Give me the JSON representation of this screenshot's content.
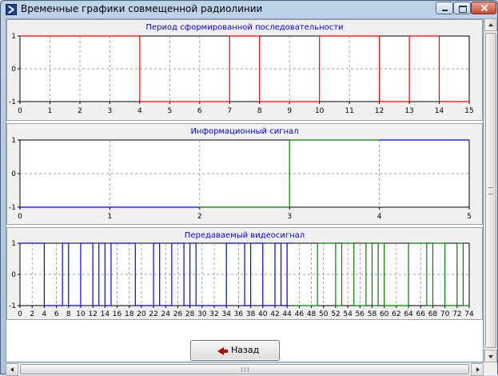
{
  "window": {
    "title": "Временные графики совмещенной радиолинии",
    "controls": [
      "minimize",
      "maximize",
      "close"
    ]
  },
  "icons": {
    "app": "app-icon",
    "back": "red-left-arrow-icon"
  },
  "buttons": {
    "back_label": "Назад"
  },
  "colors": {
    "panel_bg": "#f0f0f0",
    "plot_bg": "#ffffff",
    "grid": "#808080",
    "title_text": "#0000ff",
    "red_series": "#ff0000",
    "blue_series": "#0000ff",
    "green_series": "#008000"
  },
  "chart_data": [
    {
      "type": "line",
      "step": true,
      "title": "Период сформированной последовательности",
      "xlim": [
        0,
        15
      ],
      "ylim": [
        -1,
        1
      ],
      "xticks": [
        0,
        1,
        2,
        3,
        4,
        5,
        6,
        7,
        8,
        9,
        10,
        11,
        12,
        13,
        14,
        15
      ],
      "yticks": [
        1,
        0,
        -1
      ],
      "grid": true,
      "series": [
        {
          "color": "#ff0000",
          "x": [
            0,
            4,
            7,
            8,
            10,
            12,
            13,
            14,
            15
          ],
          "y": [
            1,
            -1,
            1,
            -1,
            1,
            -1,
            1,
            -1,
            -1
          ]
        }
      ]
    },
    {
      "type": "line",
      "step": true,
      "title": "Информационный сигнал",
      "xlim": [
        0,
        5
      ],
      "ylim": [
        -1,
        1
      ],
      "xticks": [
        0,
        1,
        2,
        3,
        4,
        5
      ],
      "yticks": [
        1,
        0,
        -1
      ],
      "grid": true,
      "series": [
        {
          "color": "#0000ff",
          "x": [
            0,
            2
          ],
          "y": [
            -1,
            -1
          ]
        },
        {
          "color": "#008000",
          "x": [
            2,
            3,
            4
          ],
          "y": [
            -1,
            1,
            1
          ]
        },
        {
          "color": "#0000ff",
          "x": [
            4,
            5
          ],
          "y": [
            1,
            1
          ]
        }
      ]
    },
    {
      "type": "line",
      "step": true,
      "title": "Передаваемый видеосигнал",
      "xlim": [
        0,
        74
      ],
      "ylim": [
        -1,
        1
      ],
      "xticks": [
        0,
        2,
        4,
        6,
        8,
        10,
        12,
        14,
        16,
        18,
        20,
        22,
        24,
        26,
        28,
        30,
        32,
        34,
        36,
        38,
        40,
        42,
        44,
        46,
        48,
        50,
        52,
        54,
        56,
        58,
        60,
        62,
        64,
        66,
        68,
        70,
        72,
        74
      ],
      "yticks": [
        1,
        0,
        -1
      ],
      "grid": true,
      "series": [
        {
          "color": "#0000ff",
          "x": [
            0,
            4,
            7,
            8,
            10,
            12,
            13,
            14,
            15,
            19,
            22,
            23,
            25,
            27,
            28,
            29,
            30,
            34,
            37,
            38,
            40,
            42,
            43,
            44,
            45
          ],
          "y": [
            1,
            -1,
            1,
            -1,
            1,
            -1,
            1,
            -1,
            1,
            -1,
            1,
            -1,
            1,
            -1,
            1,
            -1,
            -1,
            1,
            -1,
            1,
            -1,
            1,
            -1,
            1,
            1
          ]
        },
        {
          "color": "#008000",
          "x": [
            45,
            49,
            52,
            53,
            55,
            57,
            58,
            59,
            60,
            64,
            67,
            68,
            70,
            72,
            73,
            74
          ],
          "y": [
            -1,
            1,
            -1,
            1,
            -1,
            1,
            -1,
            1,
            -1,
            1,
            -1,
            1,
            -1,
            1,
            -1,
            -1
          ]
        }
      ]
    }
  ]
}
